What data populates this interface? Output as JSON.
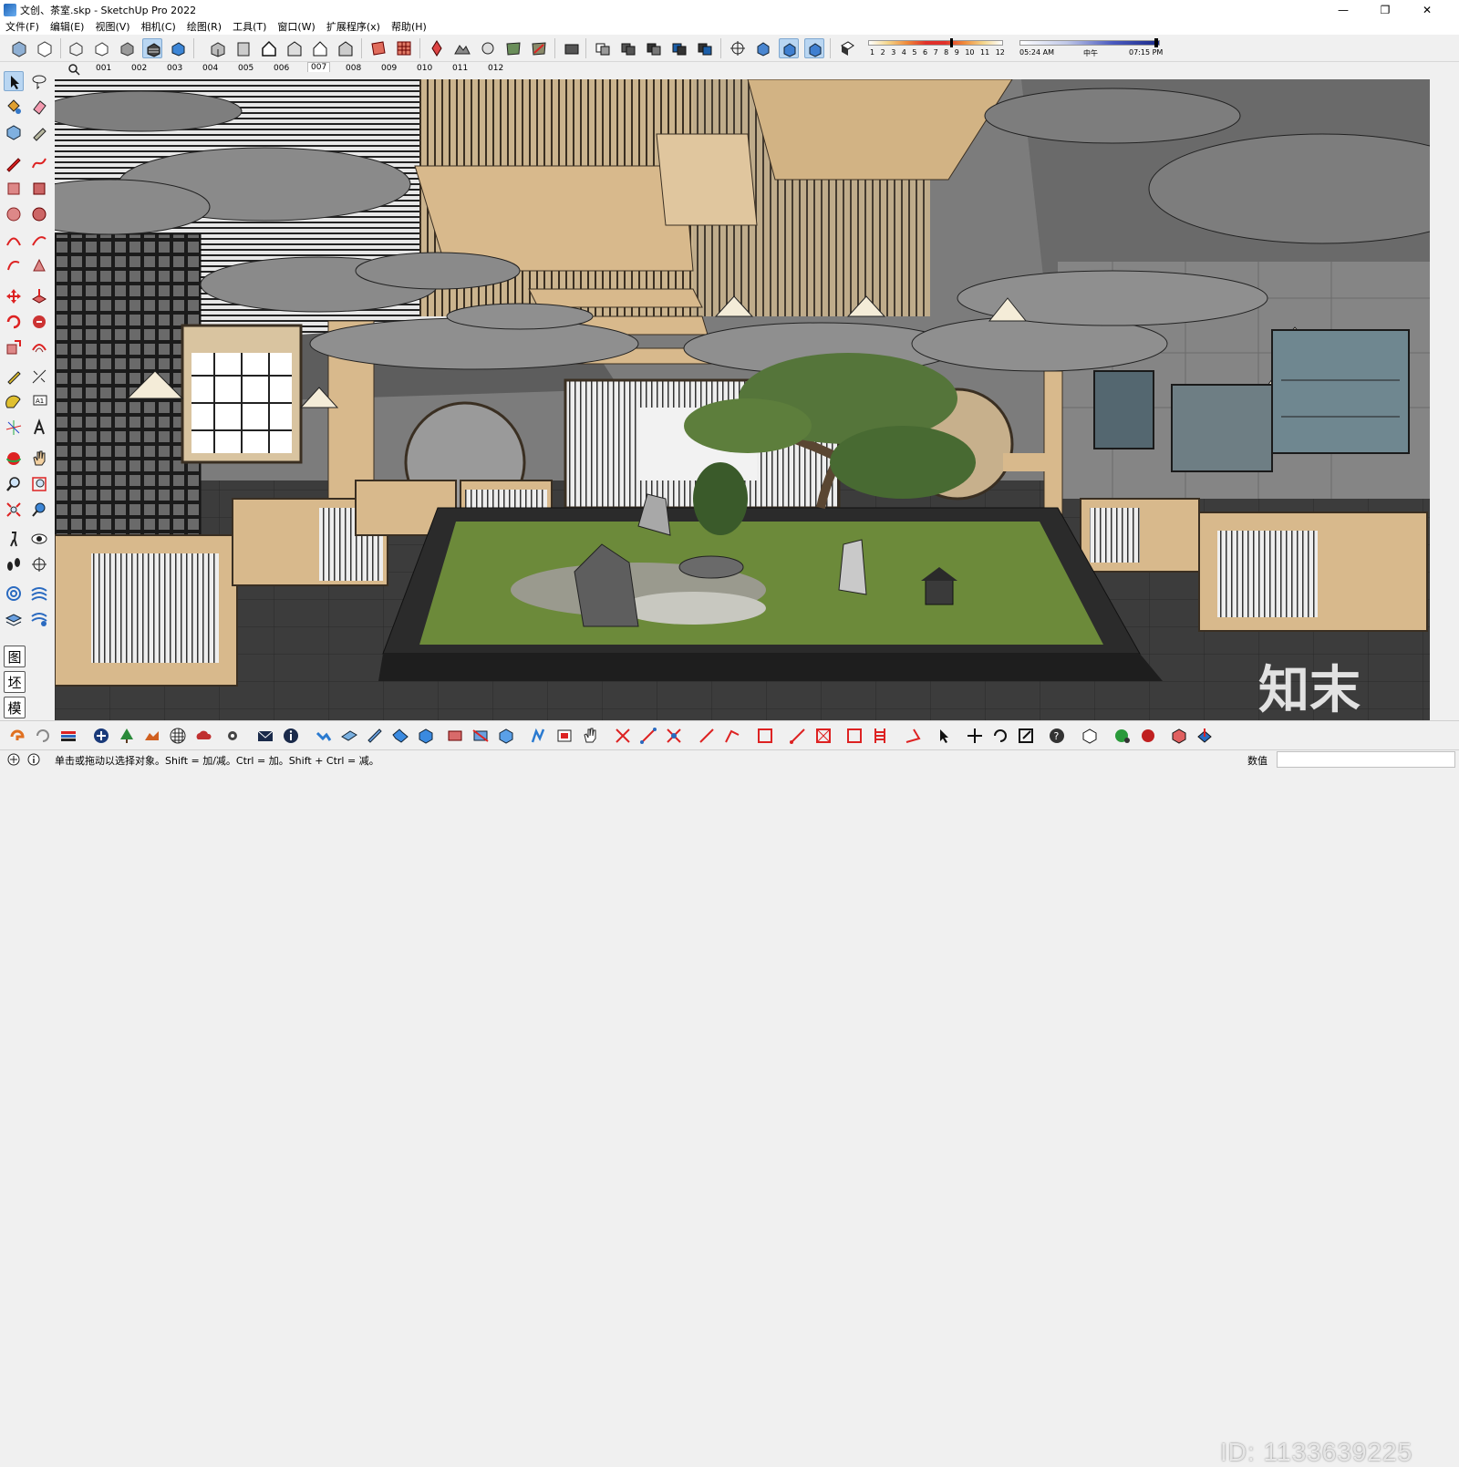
{
  "window": {
    "title": "文创、茶室.skp - SketchUp Pro 2022",
    "minimize": "—",
    "maximize": "❐",
    "close": "✕"
  },
  "menu": [
    "文件(F)",
    "编辑(E)",
    "视图(V)",
    "相机(C)",
    "绘图(R)",
    "工具(T)",
    "窗口(W)",
    "扩展程序(x)",
    "帮助(H)"
  ],
  "shadow": {
    "months": [
      "1",
      "2",
      "3",
      "4",
      "5",
      "6",
      "7",
      "8",
      "9",
      "10",
      "11",
      "12"
    ],
    "time_start": "05:24 AM",
    "time_mid": "中午",
    "time_end": "07:15 PM"
  },
  "scenes": [
    "001",
    "002",
    "003",
    "004",
    "005",
    "006",
    "007",
    "008",
    "009",
    "010",
    "011",
    "012"
  ],
  "active_scene": "007",
  "left_tray": [
    "图",
    "坯",
    "模"
  ],
  "status": {
    "hint": "单击或拖动以选择对象。Shift = 加/减。Ctrl = 加。Shift + Ctrl = 减。",
    "measurements_label": "数值",
    "measurements_value": ""
  },
  "watermark": {
    "id": "ID: 1133639225",
    "logo": "知末"
  },
  "colors": {
    "accent_active": "#b9d6f2",
    "toolbar_bg": "#f0f0f0",
    "floor": "#3c3c3c",
    "wall": "#7c7c7c",
    "wood": "#d8b98c",
    "moss": "#6c8a3a"
  }
}
